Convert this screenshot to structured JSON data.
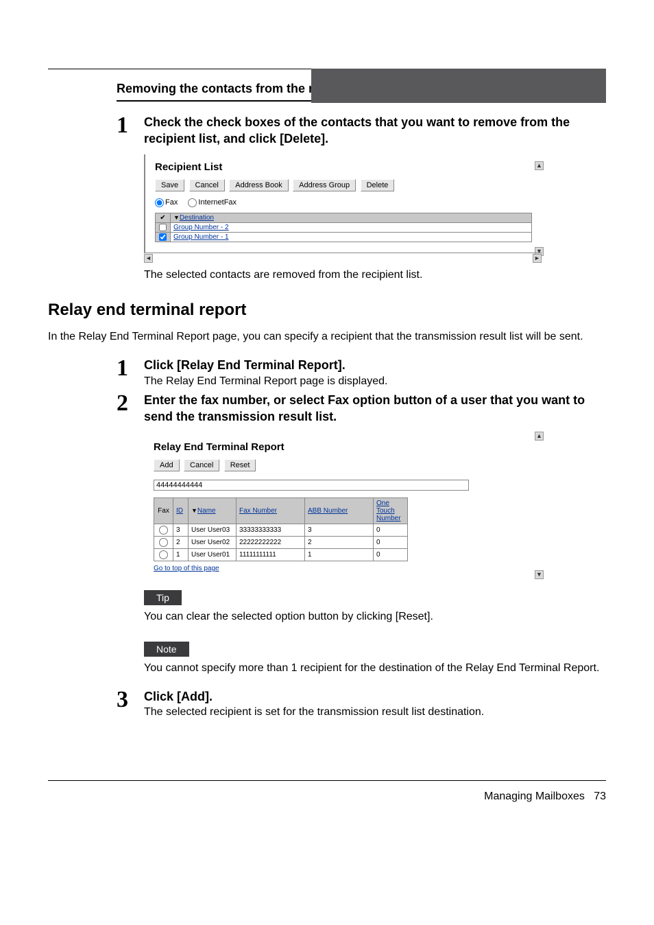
{
  "header": {},
  "section1": {
    "title": "Removing the contacts from the recipient list",
    "step1": {
      "num": "1",
      "head": "Check the check boxes of the contacts that you want to remove from the recipient list, and click [Delete].",
      "after": "The selected contacts are removed from the recipient list."
    }
  },
  "recipient_list": {
    "title": "Recipient List",
    "buttons": {
      "save": "Save",
      "cancel": "Cancel",
      "address_book": "Address Book",
      "address_group": "Address Group",
      "delete": "Delete"
    },
    "radios": {
      "fax": "Fax",
      "ifax": "InternetFax"
    },
    "header_check_icon": "✔",
    "dest_arrow": "▼",
    "dest_label": "Destination",
    "rows": [
      {
        "checked": false,
        "label": "Group Number - 2"
      },
      {
        "checked": true,
        "label": "Group Number - 1"
      }
    ]
  },
  "section2": {
    "title": "Relay end terminal report",
    "intro": "In the Relay End Terminal Report page, you can specify a recipient that the transmission result list will be sent.",
    "step1": {
      "num": "1",
      "head": "Click [Relay End Terminal Report].",
      "desc": "The Relay End Terminal Report page is displayed."
    },
    "step2": {
      "num": "2",
      "head": "Enter the fax number, or select Fax option button of a user that you want to send the transmission result list."
    },
    "tip_label": "Tip",
    "tip_text": "You can clear the selected option button by clicking [Reset].",
    "note_label": "Note",
    "note_text": "You cannot specify more than 1 recipient for the destination of the Relay End Terminal Report.",
    "step3": {
      "num": "3",
      "head": "Click [Add].",
      "desc": "The selected recipient is set for the transmission result list destination."
    }
  },
  "ret": {
    "title": "Relay End Terminal Report",
    "buttons": {
      "add": "Add",
      "cancel": "Cancel",
      "reset": "Reset"
    },
    "input_value": "44444444444",
    "cols": {
      "fax": "Fax",
      "id": "ID",
      "name_arrow": "▼",
      "name": "Name",
      "faxnum": "Fax Number",
      "abbnum": "ABB  Number",
      "one_touch": "One Touch Number"
    },
    "rows": [
      {
        "id": "3",
        "name": "User User03",
        "fax": "33333333333",
        "abb": "3",
        "one": "0"
      },
      {
        "id": "2",
        "name": "User User02",
        "fax": "22222222222",
        "abb": "2",
        "one": "0"
      },
      {
        "id": "1",
        "name": "User User01",
        "fax": "11111111111",
        "abb": "1",
        "one": "0"
      }
    ],
    "goto_top": "Go to top of this page"
  },
  "footer": {
    "section": "Managing Mailboxes",
    "page": "73"
  },
  "glyphs": {
    "tri_up": "▲",
    "tri_down": "▼",
    "tri_left": "◄",
    "tri_right": "►"
  }
}
